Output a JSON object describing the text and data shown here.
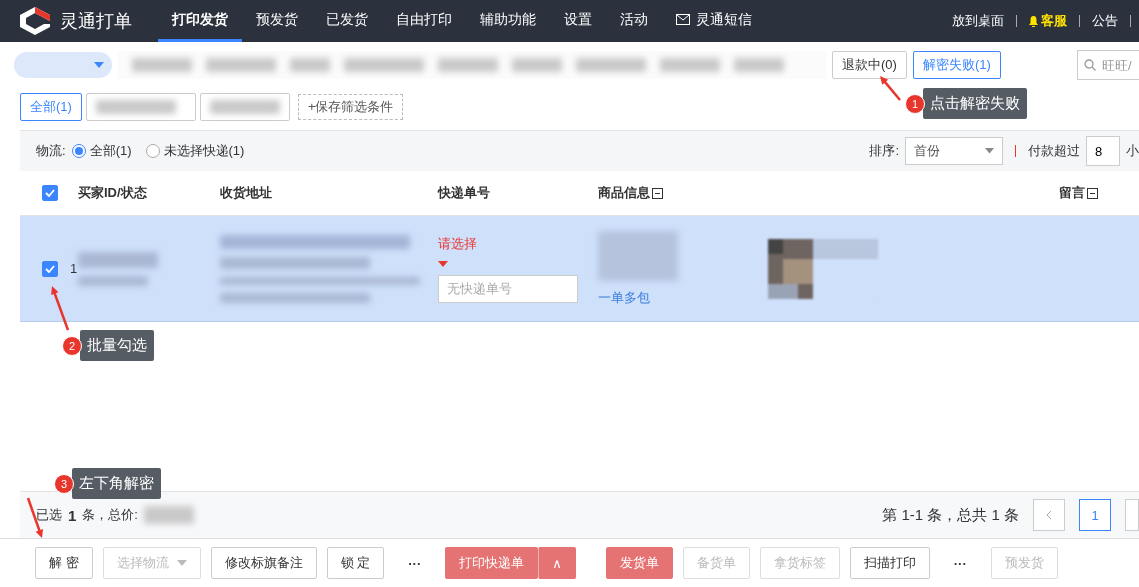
{
  "brand": {
    "name": "灵通打单"
  },
  "nav": [
    {
      "label": "打印发货",
      "selected": true
    },
    {
      "label": "预发货",
      "selected": false
    },
    {
      "label": "已发货",
      "selected": false
    },
    {
      "label": "自由打印",
      "selected": false
    },
    {
      "label": "辅助功能",
      "selected": false
    },
    {
      "label": "设置",
      "selected": false
    },
    {
      "label": "活动",
      "selected": false
    },
    {
      "label": "灵通短信",
      "selected": false,
      "kind": "mail"
    }
  ],
  "nav_right": [
    {
      "label": "放到桌面",
      "kind": "plain"
    },
    {
      "label": "客服",
      "kind": "service"
    },
    {
      "label": "公告",
      "kind": "plain"
    }
  ],
  "status_tabs": [
    {
      "label": "退款中(0)",
      "selected": false
    },
    {
      "label": "解密失败(1)",
      "selected": true
    }
  ],
  "search": {
    "placeholder": "旺旺/"
  },
  "filters": [
    {
      "label": "全部(1)",
      "selected": true
    }
  ],
  "save_filter": "+保存筛选条件",
  "logistics": {
    "label": "物流:",
    "options": [
      {
        "label": "全部(1)",
        "selected": true
      },
      {
        "label": "未选择快递(1)",
        "selected": false
      }
    ]
  },
  "sort": {
    "label": "排序:",
    "value": "首份"
  },
  "paid_over": {
    "label": "付款超过",
    "value": "8",
    "unit": "小"
  },
  "table": {
    "all_checked": true,
    "columns": [
      "买家ID/状态",
      "收货地址",
      "快递单号",
      "商品信息",
      "留言"
    ],
    "rows": [
      {
        "checked": true,
        "index": "1",
        "courier": "请选择",
        "tracking_placeholder": "无快递单号",
        "multi_package": "一单多包"
      }
    ]
  },
  "summary": {
    "selected_label": "已选",
    "count": "1",
    "total_label": "条，总价:",
    "range": "第 1-1 条，总共 1 条",
    "pages": [
      {
        "label": "1",
        "selected": true
      }
    ]
  },
  "actions": [
    {
      "label": "解 密",
      "kind": "normal",
      "disabled": false
    },
    {
      "label": "选择物流",
      "kind": "dropdown",
      "disabled": true
    },
    {
      "label": "修改标旗备注",
      "kind": "normal",
      "disabled": false
    },
    {
      "label": "锁 定",
      "kind": "normal",
      "disabled": false
    },
    {
      "label": "···",
      "kind": "more",
      "disabled": false
    },
    {
      "label": "打印快递单",
      "kind": "primary",
      "disabled": true
    },
    {
      "label": "∧",
      "kind": "primary-side",
      "disabled": true
    },
    {
      "label": "发货单",
      "kind": "primary",
      "disabled": true
    },
    {
      "label": "备货单",
      "kind": "normal",
      "disabled": true
    },
    {
      "label": "拿货标签",
      "kind": "normal",
      "disabled": true
    },
    {
      "label": "扫描打印",
      "kind": "normal",
      "disabled": false
    },
    {
      "label": "···",
      "kind": "more",
      "disabled": false
    },
    {
      "label": "预发货",
      "kind": "normal",
      "disabled": true
    }
  ],
  "callouts": [
    {
      "number": "1",
      "text": "点击解密失败"
    },
    {
      "number": "2",
      "text": "批量勾选"
    },
    {
      "number": "3",
      "text": "左下角解密"
    }
  ]
}
